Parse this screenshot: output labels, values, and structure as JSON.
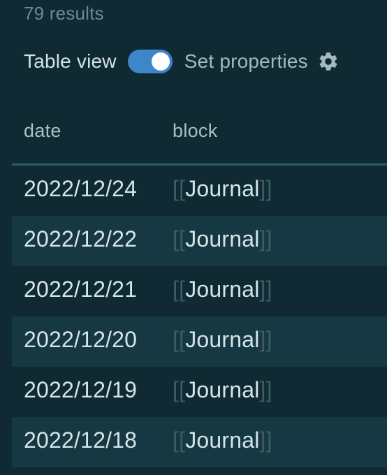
{
  "results": {
    "count_text": "79 results"
  },
  "controls": {
    "table_view_label": "Table view",
    "table_view_enabled": true,
    "set_properties_label": "Set properties",
    "gear_icon": "gear-icon"
  },
  "table": {
    "columns": [
      "date",
      "block"
    ],
    "bracket_open": "[[",
    "bracket_close": "]]",
    "rows": [
      {
        "date": "2022/12/24",
        "block": "Journal"
      },
      {
        "date": "2022/12/22",
        "block": "Journal"
      },
      {
        "date": "2022/12/21",
        "block": "Journal"
      },
      {
        "date": "2022/12/20",
        "block": "Journal"
      },
      {
        "date": "2022/12/19",
        "block": "Journal"
      },
      {
        "date": "2022/12/18",
        "block": "Journal"
      }
    ]
  },
  "colors": {
    "background": "#0f2a33",
    "alt_row": "#163842",
    "toggle_on": "#3d86c8",
    "header_rule": "#2e5b68"
  }
}
